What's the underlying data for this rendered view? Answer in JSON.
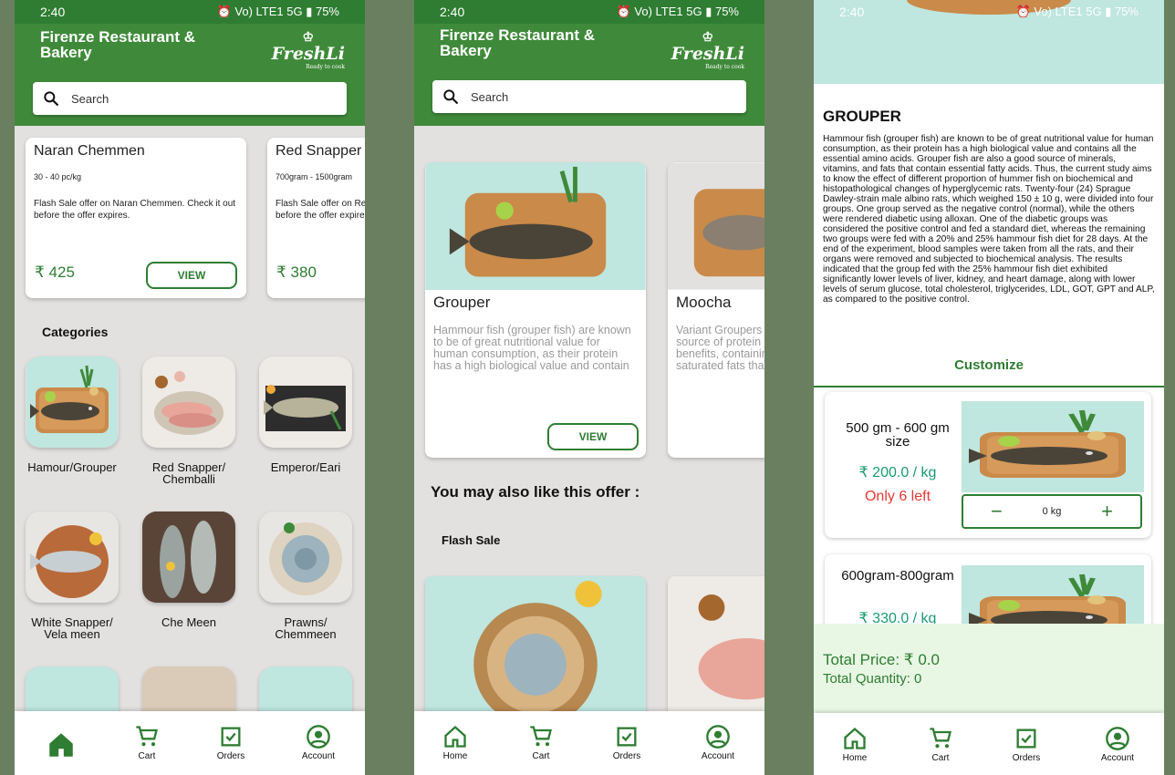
{
  "status": {
    "time": "2:40",
    "battery": "75%",
    "net": "Vo) LTE1 5G"
  },
  "app": {
    "title": "Firenze Restaurant & Bakery",
    "logo": "FreshLi",
    "logo_tagline": "Ready to cook",
    "search_placeholder": "Search"
  },
  "screen1": {
    "offers": [
      {
        "name": "Naran Chemmen",
        "size": "30 - 40 pc/kg",
        "desc": "Flash Sale offer on Naran Chemmen. Check it out before the offer expires.",
        "price": "₹ 425",
        "button": "VIEW"
      },
      {
        "name": "Red Snapper",
        "size": "700gram - 1500gram",
        "desc": "Flash Sale offer on Red Snapper. Check it out before the offer expires.",
        "price": "₹ 380"
      }
    ],
    "categories_title": "Categories",
    "categories": [
      {
        "label": "Hamour/Grouper"
      },
      {
        "label": "Red Snapper/ Chemballi"
      },
      {
        "label": "Emperor/Eari"
      },
      {
        "label": "White Snapper/ Vela meen"
      },
      {
        "label": "Che Meen"
      },
      {
        "label": "Prawns/ Chemmeen"
      }
    ]
  },
  "screen2": {
    "products": [
      {
        "name": "Grouper",
        "desc": "Hammour fish (grouper fish) are known to be of great nutritional value for human consumption, as their protein has a high biological value and contain",
        "button": "VIEW"
      },
      {
        "name": "Moocha",
        "desc": "Variant Groupers are an excellent source of protein and allied health benefits, containing large quantities of saturated fats that"
      }
    ],
    "also_like": "You may also like this offer :",
    "flash_sale": "Flash Sale"
  },
  "screen3": {
    "heading": "GROUPER",
    "desc": "Hammour fish (grouper fish) are known to be of great nutritional value for human consumption, as their protein has a high biological value and contains all the essential amino acids. Grouper fish are also a good source of minerals, vitamins, and fats that contain essential fatty acids. Thus, the current study aims to know the effect of different proportion of hummer fish on biochemical and histopathological changes of hyperglycemic rats. Twenty-four (24) Sprague Dawley-strain male albino rats, which weighed 150 ± 10 g, were divided into four groups. One group served as the negative control (normal), while the others were rendered diabetic using alloxan. One of the diabetic groups was considered the positive control and fed a standard diet, whereas the remaining two groups were fed with a 20% and 25% hammour fish diet for 28 days. At the end of the experiment, blood samples were taken from all the rats, and their organs were removed and subjected to biochemical analysis. The results indicated that the group fed with the 25% hammour fish diet exhibited significantly lower levels of liver, kidney, and heart damage, along with lower levels of serum glucose, total cholesterol, triglycerides, LDL, GOT, GPT and ALP, as compared to the positive control.",
    "customize": "Customize",
    "options": [
      {
        "size": "500 gm - 600 gm size",
        "price": "₹ 200.0 / kg",
        "stock": "Only 6 left",
        "qty": "0 kg"
      },
      {
        "size": "600gram-800gram",
        "price": "₹ 330.0 / kg"
      }
    ],
    "total_price": "Total Price: ₹ 0.0",
    "total_qty": "Total Quantity: 0"
  },
  "nav": {
    "home": "Home",
    "cart": "Cart",
    "orders": "Orders",
    "account": "Account"
  },
  "colors": {
    "primary": "#3f8a3a",
    "dark": "#2e7d32",
    "price_teal": "#1a9a6e",
    "stock_red": "#e53935"
  }
}
